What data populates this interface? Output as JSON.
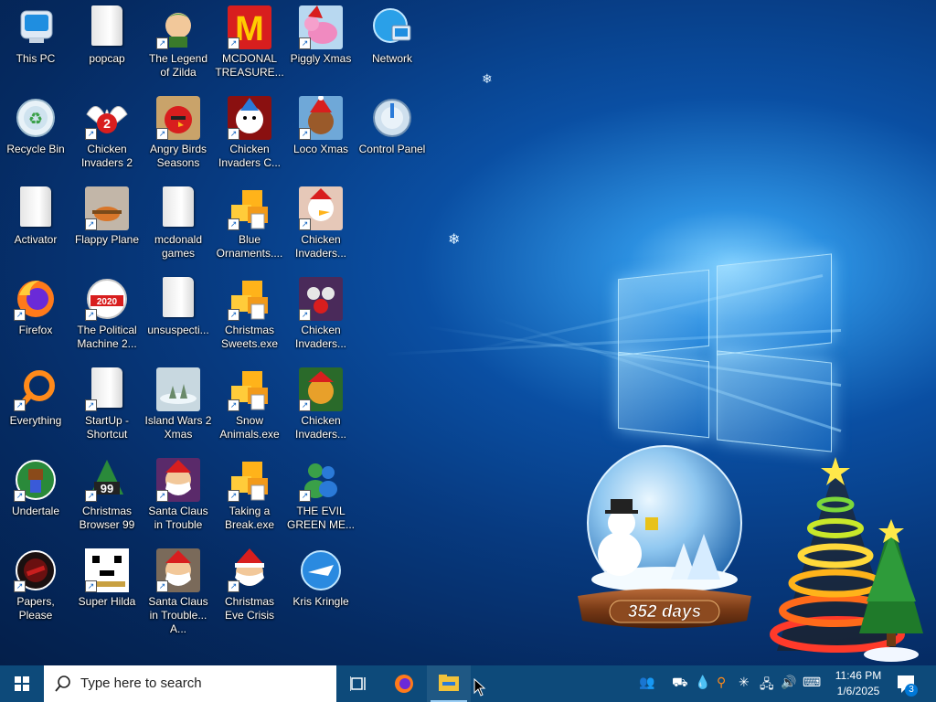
{
  "desktop": {
    "icons": [
      {
        "id": "this-pc",
        "label": "This PC"
      },
      {
        "id": "popcap",
        "label": "popcap"
      },
      {
        "id": "legend-of-zilda",
        "label": "The Legend of Zilda"
      },
      {
        "id": "mcdonal-treasure",
        "label": "MCDONAL TREASURE..."
      },
      {
        "id": "piggly-xmas",
        "label": "Piggly Xmas"
      },
      {
        "id": "network",
        "label": "Network"
      },
      {
        "id": "recycle-bin",
        "label": "Recycle Bin"
      },
      {
        "id": "chicken-invaders-2",
        "label": "Chicken Invaders 2"
      },
      {
        "id": "angry-birds-seasons",
        "label": "Angry Birds Seasons"
      },
      {
        "id": "chicken-invaders-c",
        "label": "Chicken Invaders C..."
      },
      {
        "id": "loco-xmas",
        "label": "Loco Xmas"
      },
      {
        "id": "control-panel",
        "label": "Control Panel"
      },
      {
        "id": "activator",
        "label": "Activator"
      },
      {
        "id": "flappy-plane",
        "label": "Flappy Plane"
      },
      {
        "id": "mcdonald-games",
        "label": "mcdonald games"
      },
      {
        "id": "blue-ornaments",
        "label": "Blue Ornaments...."
      },
      {
        "id": "chicken-invaders-3",
        "label": "Chicken Invaders..."
      },
      {
        "id": "firefox",
        "label": "Firefox"
      },
      {
        "id": "political-machine",
        "label": "The Political Machine 2..."
      },
      {
        "id": "unsuspecti",
        "label": "unsuspecti..."
      },
      {
        "id": "christmas-sweets",
        "label": "Christmas Sweets.exe"
      },
      {
        "id": "chicken-invaders-4",
        "label": "Chicken Invaders..."
      },
      {
        "id": "everything",
        "label": "Everything"
      },
      {
        "id": "startup-shortcut",
        "label": "StartUp - Shortcut"
      },
      {
        "id": "island-wars-2-xmas",
        "label": "Island Wars 2 Xmas"
      },
      {
        "id": "snow-animals",
        "label": "Snow Animals.exe"
      },
      {
        "id": "chicken-invaders-5",
        "label": "Chicken Invaders..."
      },
      {
        "id": "undertale",
        "label": "Undertale"
      },
      {
        "id": "christmas-browser-99",
        "label": "Christmas Browser 99"
      },
      {
        "id": "santa-claus-trouble",
        "label": "Santa Claus in Trouble"
      },
      {
        "id": "taking-a-break",
        "label": "Taking a Break.exe"
      },
      {
        "id": "evil-green-me",
        "label": "THE EVIL GREEN ME..."
      },
      {
        "id": "papers-please",
        "label": "Papers, Please"
      },
      {
        "id": "super-hilda",
        "label": "Super Hilda"
      },
      {
        "id": "santa-claus-trouble-a",
        "label": "Santa Claus in Trouble... A..."
      },
      {
        "id": "christmas-eve-crisis",
        "label": "Christmas Eve Crisis"
      },
      {
        "id": "kris-kringle",
        "label": "Kris Kringle"
      }
    ],
    "countdown": "352 days"
  },
  "taskbar": {
    "search_placeholder": "Type here to search",
    "time": "11:46 PM",
    "date": "1/6/2025",
    "notification_count": "3"
  },
  "colors": {
    "taskbar": "#0d4a7a",
    "accent": "#0078d7"
  }
}
